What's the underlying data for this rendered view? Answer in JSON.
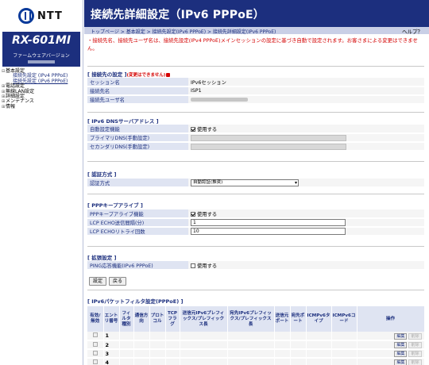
{
  "brand": {
    "logo_text": "NTT",
    "model": "RX-601MI",
    "fw_label": "ファームウェアバージョン"
  },
  "sidebar": {
    "items": [
      {
        "label": "基本設定",
        "children": [
          {
            "label": "接続先設定 (IPv4 PPPoE)"
          },
          {
            "label": "接続先設定 (IPv6 PPPoE)"
          }
        ]
      },
      {
        "label": "電話設定"
      },
      {
        "label": "無線LAN設定"
      },
      {
        "label": "詳細設定"
      },
      {
        "label": "メンテナンス"
      },
      {
        "label": "情報"
      }
    ]
  },
  "header": {
    "title": "接続先詳細設定（IPv6 PPPoE）"
  },
  "breadcrumb": {
    "items": [
      "トップページ",
      "基本設定",
      "接続先設定(IPv6 PPPoE)",
      "接続先詳細設定(IPv6 PPPoE)"
    ],
    "separator": " > "
  },
  "help": "ヘルプ？",
  "notice": "・接続先名、接続先ユーザ名は、接続先設定(IPv4 PPPoE)メインセッションの設定に基づき自動で設定されます。お客さまによる変更はできません。",
  "sections": {
    "connection": {
      "title": "[ 接続先の設定 ]",
      "note": "(変更はできません)",
      "rows": [
        {
          "label": "セッション名",
          "value": "IPv6セッション"
        },
        {
          "label": "接続先名",
          "value": "ISP1"
        },
        {
          "label": "接続先ユーザ名",
          "value": ""
        }
      ]
    },
    "dns": {
      "title": "[ IPv6 DNSサーバアドレス ]",
      "auto_label": "自動設定機能",
      "auto_value": "使用する",
      "primary_label": "プライマリDNS(手動設定)",
      "secondary_label": "セカンダリDNS(手動設定)"
    },
    "auth": {
      "title": "[ 認証方式 ]",
      "label": "認証方式",
      "value": "自動認証(推奨)"
    },
    "keepalive": {
      "title": "[ PPPキープアライブ ]",
      "enable_label": "PPPキープアライブ機能",
      "enable_value": "使用する",
      "interval_label": "LCP ECHO送信間隔(分)",
      "interval_value": "1",
      "retry_label": "LCP ECHOリトライ回数",
      "retry_value": "10"
    },
    "extended": {
      "title": "[ 拡張設定 ]",
      "ping_label": "PING応答機能(IPv6 PPPoE)",
      "ping_value": "使用する"
    }
  },
  "buttons": {
    "set": "設定",
    "back": "戻る"
  },
  "filter": {
    "title": "[ IPv6パケットフィルタ設定(PPPoE) ]",
    "columns": [
      "有効/無効",
      "エントリ番号",
      "フィルタ種別",
      "通信方向",
      "プロトコル",
      "TCPフラグ",
      "送信元IPv6プレフィックス/プレフィックス長",
      "宛先IPv6プレフィックス/プレフィックス長",
      "送信元ポート",
      "宛先ポート",
      "ICMPv6タイプ",
      "ICMPv6コード",
      "操作"
    ],
    "rows": [
      {
        "num": "1"
      },
      {
        "num": "2"
      },
      {
        "num": "3"
      },
      {
        "num": "4"
      }
    ],
    "edit_label": "編集",
    "delete_label": "削除"
  }
}
